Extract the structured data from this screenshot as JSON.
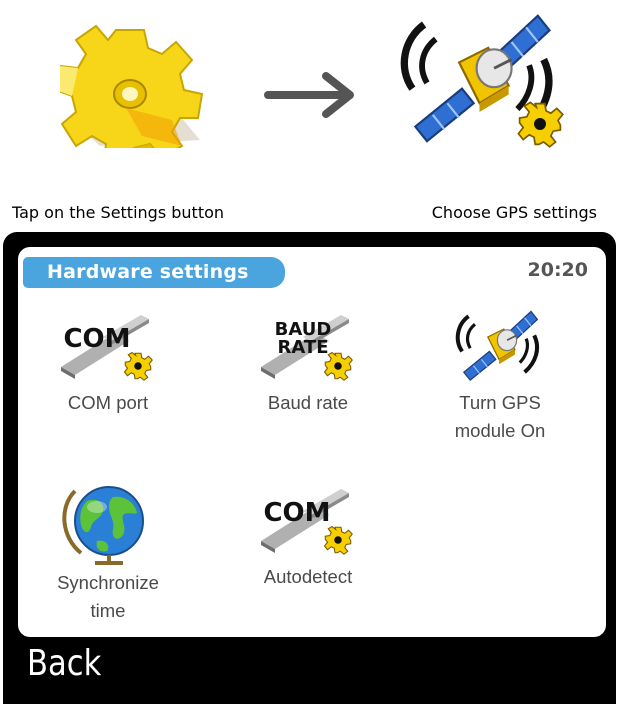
{
  "instructions": {
    "step1_caption": "Tap on the Settings button",
    "step2_caption": "Choose GPS settings"
  },
  "icons": {
    "settings": "gear-icon",
    "arrow": "arrow-right-icon",
    "gps": "satellite-icon"
  },
  "device": {
    "title": "Hardware settings",
    "time": "20:20",
    "back_label": "Back",
    "items": [
      {
        "label": "COM port",
        "icon": "com-port-icon",
        "icon_text": "COM"
      },
      {
        "label": "Baud rate",
        "icon": "baud-rate-icon",
        "icon_text_1": "BAUD",
        "icon_text_2": "RATE"
      },
      {
        "label_1": "Turn GPS",
        "label_2": "module On",
        "icon": "satellite-icon"
      },
      {
        "label_1": "Synchronize",
        "label_2": "time",
        "icon": "globe-icon"
      },
      {
        "label": "Autodetect",
        "icon": "autodetect-icon",
        "icon_text": "COM"
      }
    ]
  },
  "colors": {
    "title_pill": "#4aa4de",
    "device_frame": "#000000",
    "gear_yellow": "#f5d000"
  }
}
